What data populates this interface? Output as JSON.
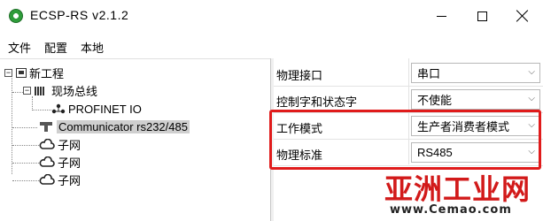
{
  "window": {
    "title": "ECSP-RS v2.1.2",
    "icons": {
      "app": "app-logo-icon",
      "minimize": "minimize-icon",
      "maximize": "maximize-icon",
      "close": "close-icon"
    }
  },
  "menu": [
    "文件",
    "配置",
    "本地"
  ],
  "tree": {
    "root": {
      "label": "新工程",
      "expander": "−"
    },
    "fieldbus": {
      "label": "现场总线",
      "expander": "−"
    },
    "profinet": {
      "label": "PROFINET IO"
    },
    "communicator": {
      "label": "Communicator rs232/485"
    },
    "subnets": [
      "子网",
      "子网",
      "子网"
    ]
  },
  "properties": [
    {
      "name": "物理接口",
      "value": "串口"
    },
    {
      "name": "控制字和状态字",
      "value": "不使能"
    },
    {
      "name": "工作模式",
      "value": "生产者消费者模式"
    },
    {
      "name": "物理标准",
      "value": "RS485"
    }
  ],
  "watermark": {
    "title": "亚洲工业网",
    "url": "www.Cemao.com"
  },
  "colors": {
    "highlight": "#e01b1b",
    "selected": "#cfcfcf",
    "watermark": "#d21a1a"
  }
}
